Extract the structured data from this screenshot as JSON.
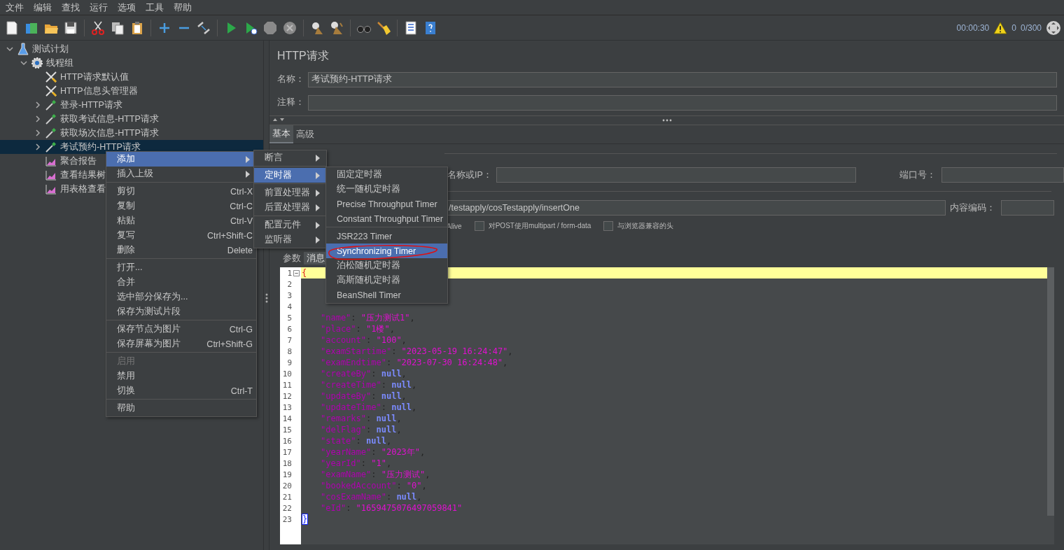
{
  "menu_bar": [
    "文件",
    "编辑",
    "查找",
    "运行",
    "选项",
    "工具",
    "帮助"
  ],
  "toolbar": {
    "elapsed": "00:00:30",
    "warnings": "0",
    "threads": "0/300"
  },
  "tree": [
    {
      "label": "测试计划",
      "kind": "plan",
      "expanded": true,
      "selected": false,
      "children": [
        {
          "label": "线程组",
          "kind": "thread-group",
          "expanded": true,
          "selected": false,
          "children": [
            {
              "label": "HTTP请求默认值",
              "kind": "config",
              "selected": false
            },
            {
              "label": "HTTP信息头管理器",
              "kind": "config",
              "selected": false
            },
            {
              "label": "登录-HTTP请求",
              "kind": "sampler",
              "expanded": false,
              "selected": false
            },
            {
              "label": "获取考试信息-HTTP请求",
              "kind": "sampler",
              "expanded": false,
              "selected": false
            },
            {
              "label": "获取场次信息-HTTP请求",
              "kind": "sampler",
              "expanded": false,
              "selected": false
            },
            {
              "label": "考试预约-HTTP请求",
              "kind": "sampler",
              "expanded": false,
              "selected": true
            },
            {
              "label": "聚合报告",
              "kind": "listener",
              "selected": false
            },
            {
              "label": "查看结果树",
              "kind": "listener",
              "selected": false
            },
            {
              "label": "用表格查看",
              "kind": "listener",
              "selected": false
            }
          ]
        }
      ]
    }
  ],
  "context_menu": [
    [
      {
        "label": "添加",
        "submenu": true,
        "selected": true
      },
      {
        "label": "插入上级",
        "submenu": true,
        "selected": false
      }
    ],
    [
      {
        "label": "剪切",
        "shortcut": "Ctrl-X",
        "selected": false
      },
      {
        "label": "复制",
        "shortcut": "Ctrl-C",
        "selected": false
      },
      {
        "label": "粘贴",
        "shortcut": "Ctrl-V",
        "selected": false
      },
      {
        "label": "复写",
        "shortcut": "Ctrl+Shift-C",
        "selected": false
      },
      {
        "label": "删除",
        "shortcut": "Delete",
        "selected": false
      }
    ],
    [
      {
        "label": "打开...",
        "selected": false
      },
      {
        "label": "合并",
        "selected": false
      },
      {
        "label": "选中部分保存为...",
        "selected": false
      },
      {
        "label": "保存为测试片段",
        "selected": false
      }
    ],
    [
      {
        "label": "保存节点为图片",
        "shortcut": "Ctrl-G",
        "selected": false
      },
      {
        "label": "保存屏幕为图片",
        "shortcut": "Ctrl+Shift-G",
        "selected": false
      }
    ],
    [
      {
        "label": "启用",
        "disabled": true,
        "selected": false
      },
      {
        "label": "禁用",
        "selected": false
      },
      {
        "label": "切换",
        "shortcut": "Ctrl-T",
        "selected": false
      }
    ],
    [
      {
        "label": "帮助",
        "selected": false
      }
    ]
  ],
  "add_submenu": [
    [
      {
        "label": "断言",
        "submenu": true,
        "selected": false
      }
    ],
    [
      {
        "label": "定时器",
        "submenu": true,
        "selected": true
      }
    ],
    [
      {
        "label": "前置处理器",
        "submenu": true,
        "selected": false
      },
      {
        "label": "后置处理器",
        "submenu": true,
        "selected": false
      }
    ],
    [
      {
        "label": "配置元件",
        "submenu": true,
        "selected": false
      },
      {
        "label": "监听器",
        "submenu": true,
        "selected": false
      }
    ]
  ],
  "timer_submenu": [
    [
      {
        "label": "固定定时器",
        "selected": false
      },
      {
        "label": "统一随机定时器",
        "selected": false
      },
      {
        "label": "Precise Throughput Timer",
        "selected": false
      },
      {
        "label": "Constant Throughput Timer",
        "selected": false
      }
    ],
    [
      {
        "label": "JSR223 Timer",
        "selected": false
      },
      {
        "label": "Synchronizing Timer",
        "selected": true
      },
      {
        "label": "泊松随机定时器",
        "selected": false
      },
      {
        "label": "高斯随机定时器",
        "selected": false
      },
      {
        "label": "BeanShell Timer",
        "selected": false
      }
    ]
  ],
  "editor": {
    "title": "HTTP请求",
    "name_label": "名称：",
    "name_value": "考试预约-HTTP请求",
    "comment_label": "注释：",
    "tabs": [
      {
        "label": "基本",
        "selected": true
      },
      {
        "label": "高级",
        "selected": false
      }
    ],
    "server_label": "名称或IP：",
    "port_label": "端口号：",
    "path_value": "/testapply/cosTestapply/insertOne",
    "encoding_label": "内容编码：",
    "keepalive_tail": "Alive",
    "checkboxes": [
      {
        "label": "对POST使用multipart / form-data",
        "checked": false
      },
      {
        "label": "与浏览器兼容的头",
        "checked": false
      }
    ],
    "body_tabs": [
      {
        "label": "参数",
        "selected": false
      },
      {
        "label": "消息",
        "selected": true
      }
    ],
    "code": [
      {
        "number": "1",
        "current": true,
        "tokens": [
          {
            "text": "{",
            "kind": "open"
          }
        ]
      },
      {
        "number": "2",
        "current": false
      },
      {
        "number": "3",
        "current": false
      },
      {
        "number": "4",
        "current": false
      },
      {
        "number": "5",
        "current": false,
        "tokens": [
          {
            "text": "\"name\"",
            "kind": "key"
          },
          {
            "text": ": ",
            "kind": "punct"
          },
          {
            "text": "\"压力测试1\"",
            "kind": "string"
          },
          {
            "text": ",",
            "kind": "punct"
          }
        ]
      },
      {
        "number": "6",
        "current": false,
        "tokens": [
          {
            "text": "\"place\"",
            "kind": "key"
          },
          {
            "text": ": ",
            "kind": "punct"
          },
          {
            "text": "\"1楼\"",
            "kind": "string"
          },
          {
            "text": ",",
            "kind": "punct"
          }
        ]
      },
      {
        "number": "7",
        "current": false,
        "tokens": [
          {
            "text": "\"account\"",
            "kind": "key"
          },
          {
            "text": ": ",
            "kind": "punct"
          },
          {
            "text": "\"100\"",
            "kind": "string"
          },
          {
            "text": ",",
            "kind": "punct"
          }
        ]
      },
      {
        "number": "8",
        "current": false,
        "tokens": [
          {
            "text": "\"examStartime\"",
            "kind": "key"
          },
          {
            "text": ": ",
            "kind": "punct"
          },
          {
            "text": "\"2023-05-19 16:24:47\"",
            "kind": "string"
          },
          {
            "text": ",",
            "kind": "punct"
          }
        ]
      },
      {
        "number": "9",
        "current": false,
        "tokens": [
          {
            "text": "\"examEndtime\"",
            "kind": "key"
          },
          {
            "text": ": ",
            "kind": "punct"
          },
          {
            "text": "\"2023-07-30 16:24:48\"",
            "kind": "string"
          },
          {
            "text": ",",
            "kind": "punct"
          }
        ]
      },
      {
        "number": "10",
        "current": false,
        "tokens": [
          {
            "text": "\"createBy\"",
            "kind": "key"
          },
          {
            "text": ": ",
            "kind": "punct"
          },
          {
            "text": "null",
            "kind": "null"
          },
          {
            "text": ",",
            "kind": "punct"
          }
        ]
      },
      {
        "number": "11",
        "current": false,
        "tokens": [
          {
            "text": "\"createTime\"",
            "kind": "key"
          },
          {
            "text": ": ",
            "kind": "punct"
          },
          {
            "text": "null",
            "kind": "null"
          },
          {
            "text": ",",
            "kind": "punct"
          }
        ]
      },
      {
        "number": "12",
        "current": false,
        "tokens": [
          {
            "text": "\"updateBy\"",
            "kind": "key"
          },
          {
            "text": ": ",
            "kind": "punct"
          },
          {
            "text": "null",
            "kind": "null"
          },
          {
            "text": ",",
            "kind": "punct"
          }
        ]
      },
      {
        "number": "13",
        "current": false,
        "tokens": [
          {
            "text": "\"updateTime\"",
            "kind": "key"
          },
          {
            "text": ": ",
            "kind": "punct"
          },
          {
            "text": "null",
            "kind": "null"
          },
          {
            "text": ",",
            "kind": "punct"
          }
        ]
      },
      {
        "number": "14",
        "current": false,
        "tokens": [
          {
            "text": "\"remarks\"",
            "kind": "key"
          },
          {
            "text": ": ",
            "kind": "punct"
          },
          {
            "text": "null",
            "kind": "null"
          },
          {
            "text": ",",
            "kind": "punct"
          }
        ]
      },
      {
        "number": "15",
        "current": false,
        "tokens": [
          {
            "text": "\"delFlag\"",
            "kind": "key"
          },
          {
            "text": ": ",
            "kind": "punct"
          },
          {
            "text": "null",
            "kind": "null"
          },
          {
            "text": ",",
            "kind": "punct"
          }
        ]
      },
      {
        "number": "16",
        "current": false,
        "tokens": [
          {
            "text": "\"state\"",
            "kind": "key"
          },
          {
            "text": ": ",
            "kind": "punct"
          },
          {
            "text": "null",
            "kind": "null"
          },
          {
            "text": ",",
            "kind": "punct"
          }
        ]
      },
      {
        "number": "17",
        "current": false,
        "tokens": [
          {
            "text": "\"yearName\"",
            "kind": "key"
          },
          {
            "text": ": ",
            "kind": "punct"
          },
          {
            "text": "\"2023年\"",
            "kind": "string"
          },
          {
            "text": ",",
            "kind": "punct"
          }
        ]
      },
      {
        "number": "18",
        "current": false,
        "tokens": [
          {
            "text": "\"yearId\"",
            "kind": "key"
          },
          {
            "text": ": ",
            "kind": "punct"
          },
          {
            "text": "\"1\"",
            "kind": "string"
          },
          {
            "text": ",",
            "kind": "punct"
          }
        ]
      },
      {
        "number": "19",
        "current": false,
        "tokens": [
          {
            "text": "\"examName\"",
            "kind": "key"
          },
          {
            "text": ": ",
            "kind": "punct"
          },
          {
            "text": "\"压力测试\"",
            "kind": "string"
          },
          {
            "text": ",",
            "kind": "punct"
          }
        ]
      },
      {
        "number": "20",
        "current": false,
        "tokens": [
          {
            "text": "\"bookedAccount\"",
            "kind": "key"
          },
          {
            "text": ": ",
            "kind": "punct"
          },
          {
            "text": "\"0\"",
            "kind": "string"
          },
          {
            "text": ",",
            "kind": "punct"
          }
        ]
      },
      {
        "number": "21",
        "current": false,
        "tokens": [
          {
            "text": "\"cosExamName\"",
            "kind": "key"
          },
          {
            "text": ": ",
            "kind": "punct"
          },
          {
            "text": "null",
            "kind": "null"
          },
          {
            "text": ",",
            "kind": "punct"
          }
        ]
      },
      {
        "number": "22",
        "current": false,
        "tokens": [
          {
            "text": "\"eId\"",
            "kind": "key"
          },
          {
            "text": ": ",
            "kind": "punct"
          },
          {
            "text": "\"1659475076497059841\"",
            "kind": "string"
          }
        ]
      },
      {
        "number": "23",
        "current": false,
        "tokens": [
          {
            "text": "}",
            "kind": "close"
          }
        ]
      }
    ]
  }
}
